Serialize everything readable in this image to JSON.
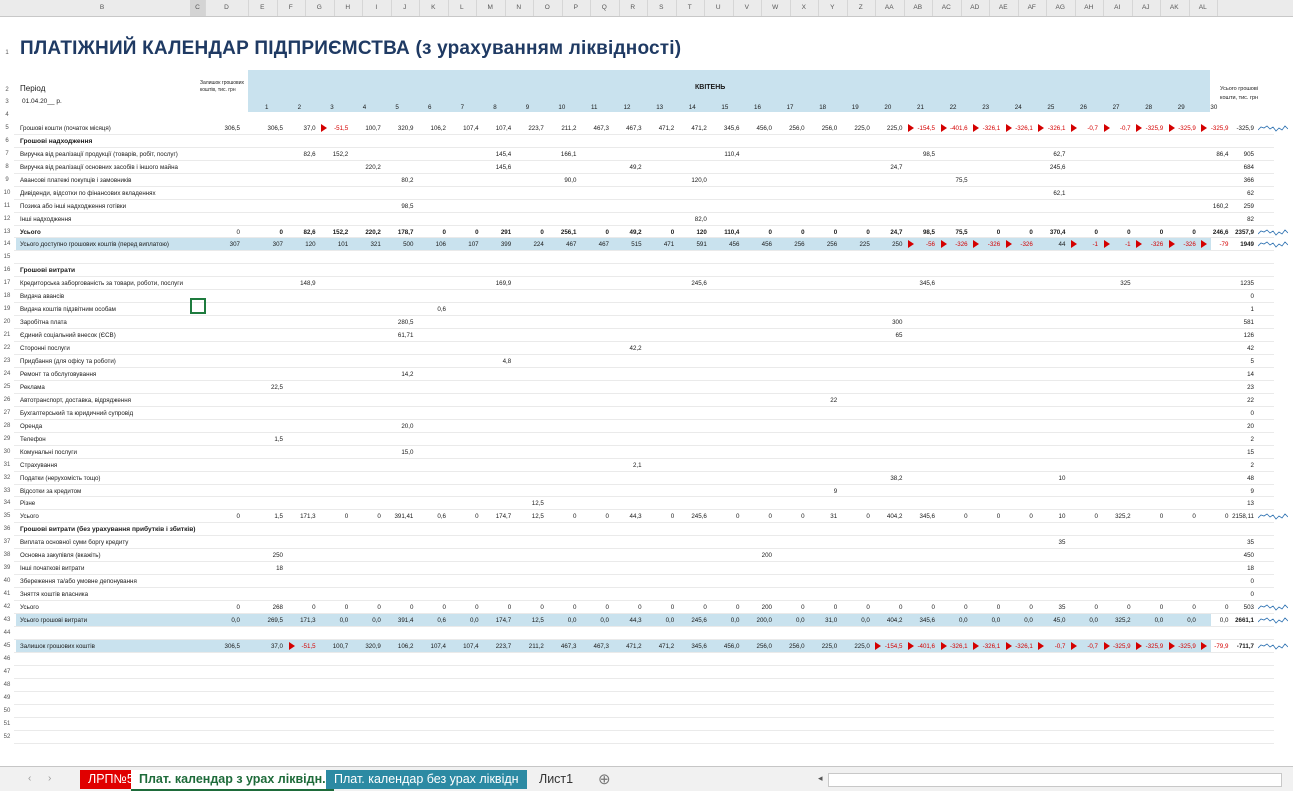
{
  "title": "ПЛАТІЖНИЙ КАЛЕНДАР ПІДПРИЄМСТВА (з урахуванням ліквідності)",
  "header": {
    "period_label": "Період",
    "period_value": "01.04.20__ р.",
    "balance_header": "Залишок грошових коштів, тис. грн",
    "month": "КВІТЕНЬ",
    "total_header": "Усього грошові кошти, тис. грн",
    "days": [
      "1",
      "2",
      "3",
      "4",
      "5",
      "6",
      "7",
      "8",
      "9",
      "10",
      "11",
      "12",
      "13",
      "14",
      "15",
      "16",
      "17",
      "18",
      "19",
      "20",
      "21",
      "22",
      "23",
      "24",
      "25",
      "26",
      "27",
      "28",
      "29",
      "30"
    ]
  },
  "columns": [
    "B",
    "C",
    "D",
    "E",
    "F",
    "G",
    "H",
    "I",
    "J",
    "K",
    "L",
    "M",
    "N",
    "O",
    "P",
    "Q",
    "R",
    "S",
    "T",
    "U",
    "V",
    "W",
    "X",
    "Y",
    "Z",
    "AA",
    "AB",
    "AC",
    "AD",
    "AE",
    "AF",
    "AG",
    "AH",
    "AI",
    "AJ",
    "AK",
    "AL"
  ],
  "rows": [
    {
      "n": "1"
    },
    {
      "n": "2"
    },
    {
      "n": "3"
    },
    {
      "n": "4"
    },
    {
      "n": "5",
      "label": "Грошові кошти (початок місяця)",
      "bal": "306,5",
      "vals": [
        "306,5",
        "37,0",
        "-51,5",
        "100,7",
        "320,9",
        "106,2",
        "107,4",
        "107,4",
        "223,7",
        "211,2",
        "467,3",
        "467,3",
        "471,2",
        "471,2",
        "345,6",
        "456,0",
        "256,0",
        "256,0",
        "225,0",
        "225,0",
        "-154,5",
        "-401,6",
        "-326,1",
        "-326,1",
        "-326,1",
        "-0,7",
        "-0,7",
        "-325,9",
        "-325,9",
        "-325,9"
      ],
      "total": "-325,9"
    },
    {
      "n": "6",
      "label": "Грошові надходження",
      "section": true
    },
    {
      "n": "7",
      "label": "Виручка від реалізації продукції (товарів, робіт, послуг)",
      "vals": [
        "",
        "82,6",
        "152,2",
        "",
        "",
        "",
        "",
        "145,4",
        "",
        "166,1",
        "",
        "",
        "",
        "",
        "110,4",
        "",
        "",
        "",
        "",
        "",
        "98,5",
        "",
        "",
        "",
        "62,7",
        "",
        "",
        "",
        "",
        "86,4"
      ],
      "total": "905"
    },
    {
      "n": "8",
      "label": "Виручка від реалізації основних засобів і іншого майна",
      "vals": [
        "",
        "",
        "",
        "220,2",
        "",
        "",
        "",
        "145,6",
        "",
        "",
        "",
        "49,2",
        "",
        "",
        "",
        "",
        "",
        "",
        "",
        "24,7",
        "",
        "",
        "",
        "",
        "245,6",
        "",
        "",
        "",
        "",
        ""
      ],
      "total": "684"
    },
    {
      "n": "9",
      "label": "Авансові платежі покупців і замовників",
      "vals": [
        "",
        "",
        "",
        "",
        "80,2",
        "",
        "",
        "",
        "",
        "90,0",
        "",
        "",
        "",
        "120,0",
        "",
        "",
        "",
        "",
        "",
        "",
        "",
        "75,5",
        "",
        "",
        "",
        "",
        "",
        "",
        "",
        ""
      ],
      "total": "366"
    },
    {
      "n": "10",
      "label": "Дивіденди, відсотки по фінансових вкладеннях",
      "vals": [
        "",
        "",
        "",
        "",
        "",
        "",
        "",
        "",
        "",
        "",
        "",
        "",
        "",
        "",
        "",
        "",
        "",
        "",
        "",
        "",
        "",
        "",
        "",
        "",
        "62,1",
        "",
        "",
        "",
        "",
        ""
      ],
      "total": "62"
    },
    {
      "n": "11",
      "label": "Позика або інші надходження готівки",
      "vals": [
        "",
        "",
        "",
        "",
        "98,5",
        "",
        "",
        "",
        "",
        "",
        "",
        "",
        "",
        "",
        "",
        "",
        "",
        "",
        "",
        "",
        "",
        "",
        "",
        "",
        "",
        "",
        "",
        "",
        "",
        "160,2"
      ],
      "total": "259"
    },
    {
      "n": "12",
      "label": "Інші надходження",
      "vals": [
        "",
        "",
        "",
        "",
        "",
        "",
        "",
        "",
        "",
        "",
        "",
        "",
        "",
        "82,0",
        "",
        "",
        "",
        "",
        "",
        "",
        "",
        "",
        "",
        "",
        "",
        "",
        "",
        "",
        "",
        ""
      ],
      "total": "82"
    },
    {
      "n": "13",
      "label": "Усього",
      "bold": true,
      "vals": [
        "0",
        "82,6",
        "152,2",
        "220,2",
        "178,7",
        "0",
        "0",
        "291",
        "0",
        "256,1",
        "0",
        "49,2",
        "0",
        "120",
        "110,4",
        "0",
        "0",
        "0",
        "0",
        "24,7",
        "98,5",
        "75,5",
        "0",
        "0",
        "370,4",
        "0",
        "0",
        "0",
        "0",
        "246,6"
      ],
      "lead": "0",
      "total": "2357,9"
    },
    {
      "n": "14",
      "label": "Усього доступно грошових коштів (перед виплатою)",
      "band": true,
      "vals": [
        "307",
        "120",
        "101",
        "321",
        "500",
        "106",
        "107",
        "399",
        "224",
        "467",
        "467",
        "515",
        "471",
        "591",
        "456",
        "456",
        "256",
        "256",
        "225",
        "250",
        "-56",
        "-326",
        "-326",
        "-326",
        "44",
        "-1",
        "-1",
        "-326",
        "-326",
        "-79"
      ],
      "lead": "307",
      "total": "1949"
    },
    {
      "n": "15"
    },
    {
      "n": "16",
      "label": "Грошові витрати",
      "section": true
    },
    {
      "n": "17",
      "label": "Кредиторська заборгованість за товари, роботи, послуги",
      "vals": [
        "",
        "148,9",
        "",
        "",
        "",
        "",
        "",
        "169,9",
        "",
        "",
        "",
        "",
        "",
        "245,6",
        "",
        "",
        "",
        "",
        "",
        "",
        "345,6",
        "",
        "",
        "",
        "",
        "",
        "325",
        "",
        "",
        ""
      ],
      "total": "1235"
    },
    {
      "n": "18",
      "label": "Видача авансів",
      "vals": [],
      "total": "0"
    },
    {
      "n": "19",
      "label": "Видача коштів підзвітним особам",
      "vals": [
        "",
        "",
        "",
        "",
        "",
        "0,6",
        "",
        "",
        "",
        "",
        "",
        "",
        "",
        "",
        "",
        "",
        "",
        "",
        "",
        "",
        "",
        "",
        "",
        "",
        "",
        "",
        "",
        "",
        "",
        ""
      ],
      "total": "1"
    },
    {
      "n": "20",
      "label": "Заробітна плата",
      "vals": [
        "",
        "",
        "",
        "",
        "280,5",
        "",
        "",
        "",
        "",
        "",
        "",
        "",
        "",
        "",
        "",
        "",
        "",
        "",
        "",
        "300",
        "",
        "",
        "",
        "",
        "",
        "",
        "",
        "",
        "",
        ""
      ],
      "total": "581"
    },
    {
      "n": "21",
      "label": "Єдиний соціальний внесок (ЄСВ)",
      "vals": [
        "",
        "",
        "",
        "",
        "61,71",
        "",
        "",
        "",
        "",
        "",
        "",
        "",
        "",
        "",
        "",
        "",
        "",
        "",
        "",
        "65",
        "",
        "",
        "",
        "",
        "",
        "",
        "",
        "",
        "",
        ""
      ],
      "total": "126"
    },
    {
      "n": "22",
      "label": "Сторонні послуги",
      "vals": [
        "",
        "",
        "",
        "",
        "",
        "",
        "",
        "",
        "",
        "",
        "",
        "42,2",
        "",
        "",
        "",
        "",
        "",
        "",
        "",
        "",
        "",
        "",
        "",
        "",
        "",
        "",
        "",
        "",
        "",
        ""
      ],
      "total": "42"
    },
    {
      "n": "23",
      "label": "Придбання (для офісу та роботи)",
      "vals": [
        "",
        "",
        "",
        "",
        "",
        "",
        "",
        "4,8",
        "",
        "",
        "",
        "",
        "",
        "",
        "",
        "",
        "",
        "",
        "",
        "",
        "",
        "",
        "",
        "",
        "",
        "",
        "",
        "",
        "",
        ""
      ],
      "total": "5"
    },
    {
      "n": "24",
      "label": "Ремонт та обслуговування",
      "vals": [
        "",
        "",
        "",
        "",
        "14,2",
        "",
        "",
        "",
        "",
        "",
        "",
        "",
        "",
        "",
        "",
        "",
        "",
        "",
        "",
        "",
        "",
        "",
        "",
        "",
        "",
        "",
        "",
        "",
        "",
        ""
      ],
      "total": "14"
    },
    {
      "n": "25",
      "label": "Реклама",
      "vals": [
        "22,5",
        "",
        "",
        "",
        "",
        "",
        "",
        "",
        "",
        "",
        "",
        "",
        "",
        "",
        "",
        "",
        "",
        "",
        "",
        "",
        "",
        "",
        "",
        "",
        "",
        "",
        "",
        "",
        "",
        ""
      ],
      "total": "23"
    },
    {
      "n": "26",
      "label": "Автотранспорт, доставка, відрядження",
      "vals": [
        "",
        "",
        "",
        "",
        "",
        "",
        "",
        "",
        "",
        "",
        "",
        "",
        "",
        "",
        "",
        "",
        "",
        "22",
        "",
        "",
        "",
        "",
        "",
        "",
        "",
        "",
        "",
        "",
        "",
        ""
      ],
      "total": "22"
    },
    {
      "n": "27",
      "label": "Бухгалтерський та юридичний супровід",
      "vals": [],
      "total": "0"
    },
    {
      "n": "28",
      "label": "Оренда",
      "vals": [
        "",
        "",
        "",
        "",
        "20,0",
        "",
        "",
        "",
        "",
        "",
        "",
        "",
        "",
        "",
        "",
        "",
        "",
        "",
        "",
        "",
        "",
        "",
        "",
        "",
        "",
        "",
        "",
        "",
        "",
        ""
      ],
      "total": "20"
    },
    {
      "n": "29",
      "label": "Телефон",
      "vals": [
        "1,5",
        "",
        "",
        "",
        "",
        "",
        "",
        "",
        "",
        "",
        "",
        "",
        "",
        "",
        "",
        "",
        "",
        "",
        "",
        "",
        "",
        "",
        "",
        "",
        "",
        "",
        "",
        "",
        "",
        ""
      ],
      "total": "2"
    },
    {
      "n": "30",
      "label": "Комунальні послуги",
      "vals": [
        "",
        "",
        "",
        "",
        "15,0",
        "",
        "",
        "",
        "",
        "",
        "",
        "",
        "",
        "",
        "",
        "",
        "",
        "",
        "",
        "",
        "",
        "",
        "",
        "",
        "",
        "",
        "",
        "",
        "",
        ""
      ],
      "total": "15"
    },
    {
      "n": "31",
      "label": "Страхування",
      "vals": [
        "",
        "",
        "",
        "",
        "",
        "",
        "",
        "",
        "",
        "",
        "",
        "2,1",
        "",
        "",
        "",
        "",
        "",
        "",
        "",
        "",
        "",
        "",
        "",
        "",
        "",
        "",
        "",
        "",
        "",
        ""
      ],
      "total": "2"
    },
    {
      "n": "32",
      "label": "Податки (нерухомість тощо)",
      "vals": [
        "",
        "",
        "",
        "",
        "",
        "",
        "",
        "",
        "",
        "",
        "",
        "",
        "",
        "",
        "",
        "",
        "",
        "",
        "",
        "38,2",
        "",
        "",
        "",
        "",
        "10",
        "",
        "",
        "",
        "",
        ""
      ],
      "total": "48"
    },
    {
      "n": "33",
      "label": "Відсотки за кредитом",
      "vals": [
        "",
        "",
        "",
        "",
        "",
        "",
        "",
        "",
        "",
        "",
        "",
        "",
        "",
        "",
        "",
        "",
        "",
        "9",
        "",
        "",
        "",
        "",
        "",
        "",
        "",
        "",
        "",
        "",
        "",
        ""
      ],
      "total": "9"
    },
    {
      "n": "34",
      "label": "Різне",
      "vals": [
        "",
        "",
        "",
        "",
        "",
        "",
        "",
        "",
        "12,5",
        "",
        "",
        "",
        "",
        "",
        "",
        "",
        "",
        "",
        "",
        "",
        "",
        "",
        "",
        "",
        "",
        "",
        "",
        "",
        "",
        ""
      ],
      "total": "13"
    },
    {
      "n": "35",
      "label": "Усього",
      "vals": [
        "1,5",
        "171,3",
        "0",
        "0",
        "391,41",
        "0,6",
        "0",
        "174,7",
        "12,5",
        "0",
        "0",
        "44,3",
        "0",
        "245,6",
        "0",
        "0",
        "0",
        "31",
        "0",
        "404,2",
        "345,6",
        "0",
        "0",
        "0",
        "10",
        "0",
        "325,2",
        "0",
        "0",
        "0"
      ],
      "lead": "0",
      "total": "2158,11"
    },
    {
      "n": "36",
      "label": "Грошові витрати (без урахування прибутків і збитків)",
      "section": true
    },
    {
      "n": "37",
      "label": "Виплата основної суми боргу кредиту",
      "vals": [
        "",
        "",
        "",
        "",
        "",
        "",
        "",
        "",
        "",
        "",
        "",
        "",
        "",
        "",
        "",
        "",
        "",
        "",
        "",
        "",
        "",
        "",
        "",
        "",
        "35",
        "",
        "",
        "",
        "",
        ""
      ],
      "total": "35"
    },
    {
      "n": "38",
      "label": "Основна закупівля (вкажіть)",
      "vals": [
        "250",
        "",
        "",
        "",
        "",
        "",
        "",
        "",
        "",
        "",
        "",
        "",
        "",
        "",
        "",
        "200",
        "",
        "",
        "",
        "",
        "",
        "",
        "",
        "",
        "",
        "",
        "",
        "",
        "",
        ""
      ],
      "total": "450"
    },
    {
      "n": "39",
      "label": "Інші початкові витрати",
      "vals": [
        "18",
        "",
        "",
        "",
        "",
        "",
        "",
        "",
        "",
        "",
        "",
        "",
        "",
        "",
        "",
        "",
        "",
        "",
        "",
        "",
        "",
        "",
        "",
        "",
        "",
        "",
        "",
        "",
        "",
        ""
      ],
      "total": "18"
    },
    {
      "n": "40",
      "label": "Збереження та/або умовне депонування",
      "vals": [],
      "total": "0"
    },
    {
      "n": "41",
      "label": "Зняття коштів власника",
      "vals": [],
      "total": "0"
    },
    {
      "n": "42",
      "label": "Усього",
      "vals": [
        "268",
        "0",
        "0",
        "0",
        "0",
        "0",
        "0",
        "0",
        "0",
        "0",
        "0",
        "0",
        "0",
        "0",
        "0",
        "200",
        "0",
        "0",
        "0",
        "0",
        "0",
        "0",
        "0",
        "0",
        "35",
        "0",
        "0",
        "0",
        "0",
        "0"
      ],
      "lead": "0",
      "total": "503"
    },
    {
      "n": "43",
      "label": "Усього грошові витрати",
      "band": true,
      "vals": [
        "269,5",
        "171,3",
        "0,0",
        "0,0",
        "391,4",
        "0,6",
        "0,0",
        "174,7",
        "12,5",
        "0,0",
        "0,0",
        "44,3",
        "0,0",
        "245,6",
        "0,0",
        "200,0",
        "0,0",
        "31,0",
        "0,0",
        "404,2",
        "345,6",
        "0,0",
        "0,0",
        "0,0",
        "45,0",
        "0,0",
        "325,2",
        "0,0",
        "0,0",
        "0,0"
      ],
      "lead": "0,0",
      "total": "2661,1"
    },
    {
      "n": "44"
    },
    {
      "n": "45",
      "label": "Залишок грошових коштів",
      "band": true,
      "vals": [
        "37,0",
        "-51,5",
        "100,7",
        "320,9",
        "106,2",
        "107,4",
        "107,4",
        "223,7",
        "211,2",
        "467,3",
        "467,3",
        "471,2",
        "471,2",
        "345,6",
        "456,0",
        "256,0",
        "256,0",
        "225,0",
        "225,0",
        "-154,5",
        "-401,6",
        "-326,1",
        "-326,1",
        "-326,1",
        "-0,7",
        "-0,7",
        "-325,9",
        "-325,9",
        "-325,9",
        "-79,9"
      ],
      "lead": "306,5",
      "total": "-711,7"
    },
    {
      "n": "46"
    },
    {
      "n": "47"
    },
    {
      "n": "48"
    },
    {
      "n": "49"
    },
    {
      "n": "50"
    },
    {
      "n": "51"
    },
    {
      "n": "52"
    }
  ],
  "tabs": [
    {
      "label": "ЛРП№5",
      "style": "red"
    },
    {
      "label": "Плат. календар з урах ліквідн.",
      "style": "active"
    },
    {
      "label": "Плат. календар без урах ліквідн",
      "style": "teal"
    },
    {
      "label": "Лист1",
      "style": "plain"
    }
  ],
  "add_sheet": "⊕",
  "colors": {
    "title": "#1f3a63",
    "band": "#c9e2ee",
    "negative": "#d40000",
    "active_tab": "#1e6b3a"
  }
}
